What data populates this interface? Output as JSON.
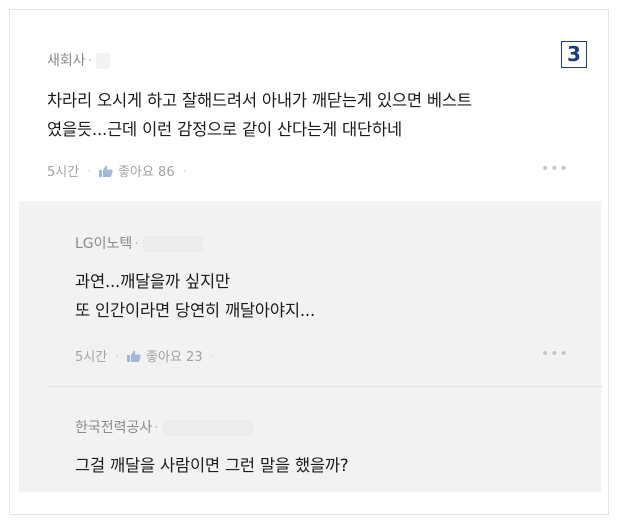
{
  "page_marker": "3",
  "comment": {
    "author": "새회사",
    "author_dot": "·",
    "text_line1": "차라리 오시게 하고 잘해드려서 아내가 깨닫는게 있으면 베스트",
    "text_line2": "였을듯...근데 이런 감정으로 같이 산다는게 대단하네",
    "time": "5시간",
    "like_label": "좋아요 86",
    "more_icon": "•••"
  },
  "replies": [
    {
      "author": "LG이노텍",
      "author_dot": "·",
      "text_line1": "과연...깨달을까 싶지만",
      "text_line2": "또 인간이라면 당연히 깨달아야지...",
      "time": "5시간",
      "like_label": "좋아요 23",
      "more_icon": "•••"
    },
    {
      "author": "한국전력공사",
      "author_dot": "·",
      "text_line1": "그걸 깨달을 사람이면 그런 말을 했을까?"
    }
  ],
  "colors": {
    "accent": "#1c3d7a",
    "like_icon": "#a3b8d8",
    "reply_bg": "#f2f2f2"
  }
}
